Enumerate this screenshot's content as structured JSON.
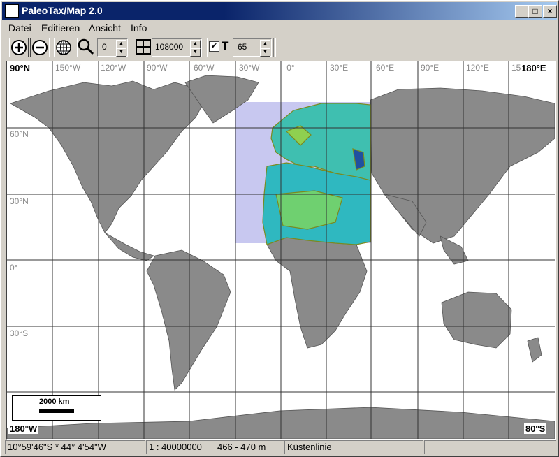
{
  "window": {
    "title": "PaleoTax/Map 2.0",
    "controls": [
      "_",
      "□",
      "×"
    ]
  },
  "menu": {
    "items": [
      "Datei",
      "Editieren",
      "Ansicht",
      "Info"
    ]
  },
  "toolbar": {
    "zoom_value": "0",
    "grid_value": "108000",
    "text_checked": true,
    "text_label": "T",
    "text_value": "65"
  },
  "map": {
    "corner_top_left": "90°N",
    "corner_top_right": "180°E",
    "corner_bottom_left": "180°W",
    "corner_bottom_right": "80°S",
    "longitudes": [
      "150°W",
      "120°W",
      "90°W",
      "60°W",
      "30°W",
      "0°",
      "30°E",
      "60°E",
      "90°E",
      "120°E",
      "15"
    ],
    "latitudes": [
      "60°N",
      "30°N",
      "0°",
      "30°S"
    ],
    "scale_label": "2000 km"
  },
  "status": {
    "coords": "10°59'46\"S * 44° 4'54\"W",
    "scale": "1 : 40000000",
    "elevation": "466 - 470 m",
    "layer": "Küstenlinie"
  }
}
